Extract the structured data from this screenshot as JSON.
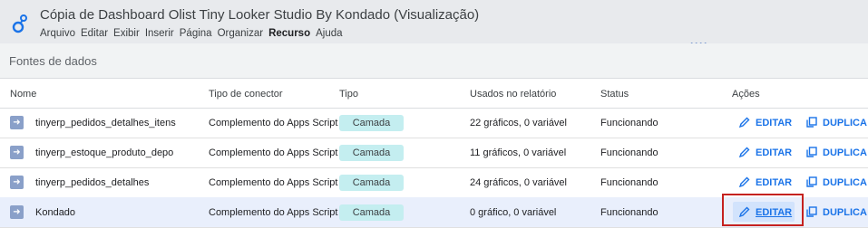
{
  "colors": {
    "accent": "#1a73e8",
    "badge_bg": "#c4eef0",
    "highlight_row": "#e9effc",
    "annotation_red": "#c5221f"
  },
  "header": {
    "title": "Cópia de Dashboard Olist Tiny Looker Studio By Kondado (Visualização)",
    "menu": [
      "Arquivo",
      "Editar",
      "Exibir",
      "Inserir",
      "Página",
      "Organizar",
      "Recurso",
      "Ajuda"
    ],
    "more_icon": "more-horizontal-icon"
  },
  "panel": {
    "title": "Fontes de dados"
  },
  "table": {
    "columns": [
      "Nome",
      "Tipo de conector",
      "Tipo",
      "Usados no relatório",
      "Status",
      "Ações"
    ],
    "rows": [
      {
        "name": "tinyerp_pedidos_detalhes_itens",
        "connector": "Complemento do Apps Script",
        "type": "Camada",
        "usage": "22 gráficos, 0 variável",
        "status": "Funcionando",
        "edit": "EDITAR",
        "duplicate": "DUPLICA"
      },
      {
        "name": "tinyerp_estoque_produto_depo",
        "connector": "Complemento do Apps Script",
        "type": "Camada",
        "usage": "11 gráficos, 0 variável",
        "status": "Funcionando",
        "edit": "EDITAR",
        "duplicate": "DUPLICA"
      },
      {
        "name": "tinyerp_pedidos_detalhes",
        "connector": "Complemento do Apps Script",
        "type": "Camada",
        "usage": "24 gráficos, 0 variável",
        "status": "Funcionando",
        "edit": "EDITAR",
        "duplicate": "DUPLICA"
      },
      {
        "name": "Kondado",
        "connector": "Complemento do Apps Script",
        "type": "Camada",
        "usage": "0 gráfico, 0 variável",
        "status": "Funcionando",
        "edit": "EDITAR",
        "duplicate": "DUPLICA"
      }
    ]
  }
}
